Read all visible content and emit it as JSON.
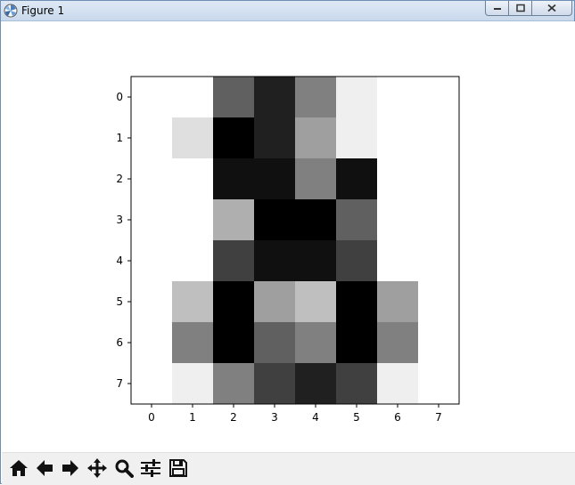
{
  "window": {
    "title": "Figure 1"
  },
  "toolbar": {
    "buttons": [
      {
        "icon": "home-icon"
      },
      {
        "icon": "back-arrow-icon"
      },
      {
        "icon": "forward-arrow-icon"
      },
      {
        "icon": "pan-move-icon"
      },
      {
        "icon": "zoom-magnifier-icon"
      },
      {
        "icon": "subplots-config-icon"
      },
      {
        "icon": "save-disk-icon"
      }
    ]
  },
  "chart_data": {
    "type": "heatmap",
    "colormap": "gray_r",
    "vmin": 0,
    "vmax": 16,
    "x_ticks": [
      "0",
      "1",
      "2",
      "3",
      "4",
      "5",
      "6",
      "7"
    ],
    "y_ticks": [
      "0",
      "1",
      "2",
      "3",
      "4",
      "5",
      "6",
      "7"
    ],
    "matrix": [
      [
        0,
        0,
        10,
        14,
        8,
        1,
        0,
        0
      ],
      [
        0,
        2,
        16,
        14,
        6,
        1,
        0,
        0
      ],
      [
        0,
        0,
        15,
        15,
        8,
        15,
        0,
        0
      ],
      [
        0,
        0,
        5,
        16,
        16,
        10,
        0,
        0
      ],
      [
        0,
        0,
        12,
        15,
        15,
        12,
        0,
        0
      ],
      [
        0,
        4,
        16,
        6,
        4,
        16,
        6,
        0
      ],
      [
        0,
        8,
        16,
        10,
        8,
        16,
        8,
        0
      ],
      [
        0,
        1,
        8,
        12,
        14,
        12,
        1,
        0
      ]
    ]
  }
}
